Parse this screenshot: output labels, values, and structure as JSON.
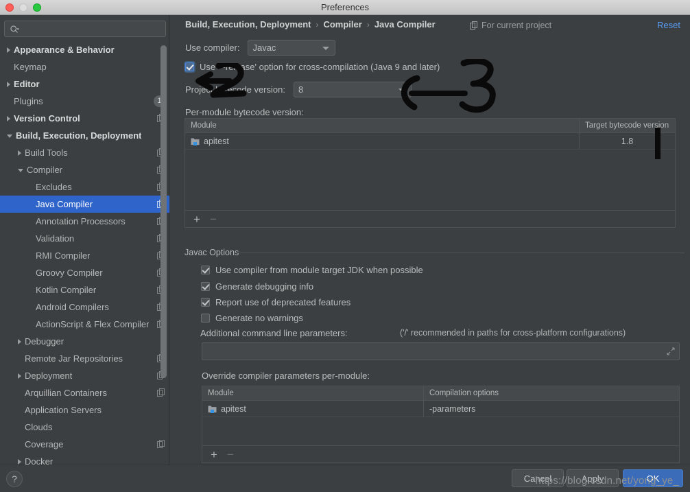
{
  "window": {
    "title": "Preferences",
    "controls": [
      "close",
      "minimize",
      "zoom"
    ]
  },
  "sidebar": {
    "search": {
      "placeholder": "",
      "icon": "search-icon"
    },
    "items": [
      {
        "label": "Appearance & Behavior",
        "depth": 0,
        "arrow": "right",
        "bold": true,
        "copy": false,
        "badge": null,
        "selected": false
      },
      {
        "label": "Keymap",
        "depth": 0,
        "arrow": "none",
        "bold": false,
        "copy": false,
        "badge": null,
        "selected": false
      },
      {
        "label": "Editor",
        "depth": 0,
        "arrow": "right",
        "bold": true,
        "copy": false,
        "badge": null,
        "selected": false
      },
      {
        "label": "Plugins",
        "depth": 0,
        "arrow": "none",
        "bold": false,
        "copy": false,
        "badge": "1",
        "selected": false
      },
      {
        "label": "Version Control",
        "depth": 0,
        "arrow": "right",
        "bold": true,
        "copy": true,
        "badge": null,
        "selected": false
      },
      {
        "label": "Build, Execution, Deployment",
        "depth": 0,
        "arrow": "down",
        "bold": true,
        "copy": false,
        "badge": null,
        "selected": false
      },
      {
        "label": "Build Tools",
        "depth": 1,
        "arrow": "right",
        "bold": false,
        "copy": true,
        "badge": null,
        "selected": false
      },
      {
        "label": "Compiler",
        "depth": 1,
        "arrow": "down",
        "bold": false,
        "copy": true,
        "badge": null,
        "selected": false
      },
      {
        "label": "Excludes",
        "depth": 2,
        "arrow": "none",
        "bold": false,
        "copy": true,
        "badge": null,
        "selected": false
      },
      {
        "label": "Java Compiler",
        "depth": 2,
        "arrow": "none",
        "bold": false,
        "copy": true,
        "badge": null,
        "selected": true
      },
      {
        "label": "Annotation Processors",
        "depth": 2,
        "arrow": "none",
        "bold": false,
        "copy": true,
        "badge": null,
        "selected": false
      },
      {
        "label": "Validation",
        "depth": 2,
        "arrow": "none",
        "bold": false,
        "copy": true,
        "badge": null,
        "selected": false
      },
      {
        "label": "RMI Compiler",
        "depth": 2,
        "arrow": "none",
        "bold": false,
        "copy": true,
        "badge": null,
        "selected": false
      },
      {
        "label": "Groovy Compiler",
        "depth": 2,
        "arrow": "none",
        "bold": false,
        "copy": true,
        "badge": null,
        "selected": false
      },
      {
        "label": "Kotlin Compiler",
        "depth": 2,
        "arrow": "none",
        "bold": false,
        "copy": true,
        "badge": null,
        "selected": false
      },
      {
        "label": "Android Compilers",
        "depth": 2,
        "arrow": "none",
        "bold": false,
        "copy": true,
        "badge": null,
        "selected": false
      },
      {
        "label": "ActionScript & Flex Compiler",
        "depth": 2,
        "arrow": "none",
        "bold": false,
        "copy": true,
        "badge": null,
        "selected": false
      },
      {
        "label": "Debugger",
        "depth": 1,
        "arrow": "right",
        "bold": false,
        "copy": false,
        "badge": null,
        "selected": false
      },
      {
        "label": "Remote Jar Repositories",
        "depth": 1,
        "arrow": "none",
        "bold": false,
        "copy": true,
        "badge": null,
        "selected": false
      },
      {
        "label": "Deployment",
        "depth": 1,
        "arrow": "right",
        "bold": false,
        "copy": true,
        "badge": null,
        "selected": false
      },
      {
        "label": "Arquillian Containers",
        "depth": 1,
        "arrow": "none",
        "bold": false,
        "copy": true,
        "badge": null,
        "selected": false
      },
      {
        "label": "Application Servers",
        "depth": 1,
        "arrow": "none",
        "bold": false,
        "copy": false,
        "badge": null,
        "selected": false
      },
      {
        "label": "Clouds",
        "depth": 1,
        "arrow": "none",
        "bold": false,
        "copy": false,
        "badge": null,
        "selected": false
      },
      {
        "label": "Coverage",
        "depth": 1,
        "arrow": "none",
        "bold": false,
        "copy": true,
        "badge": null,
        "selected": false
      },
      {
        "label": "Docker",
        "depth": 1,
        "arrow": "right",
        "bold": false,
        "copy": false,
        "badge": null,
        "selected": false
      }
    ]
  },
  "header": {
    "breadcrumb": [
      "Build, Execution, Deployment",
      "Compiler",
      "Java Compiler"
    ],
    "separator": "›",
    "scope_label": "For current project",
    "scope_icon": "copy-icon",
    "reset_label": "Reset"
  },
  "main": {
    "use_compiler_label": "Use compiler:",
    "use_compiler_value": "Javac",
    "release_option_label": "Use '--release' option for cross-compilation (Java 9 and later)",
    "release_option_checked": true,
    "project_bytecode_label": "Project bytecode version:",
    "project_bytecode_value": "8",
    "per_module_label": "Per-module bytecode version:",
    "per_module_table": {
      "headers": [
        "Module",
        "Target bytecode version"
      ],
      "rows": [
        {
          "module": "apitest",
          "target": "1.8"
        }
      ],
      "add_label": "+",
      "remove_label": "−"
    },
    "javac_group_title": "Javac Options",
    "javac_options": [
      {
        "label": "Use compiler from module target JDK when possible",
        "checked": true
      },
      {
        "label": "Generate debugging info",
        "checked": true
      },
      {
        "label": "Report use of deprecated features",
        "checked": true
      },
      {
        "label": "Generate no warnings",
        "checked": false
      }
    ],
    "additional_params_label": "Additional command line parameters:",
    "additional_params_hint": "('/' recommended in paths for cross-platform configurations)",
    "additional_params_value": "",
    "override_label": "Override compiler parameters per-module:",
    "override_table": {
      "headers": [
        "Module",
        "Compilation options"
      ],
      "rows": [
        {
          "module": "apitest",
          "options": "-parameters"
        }
      ],
      "add_label": "+",
      "remove_label": "−"
    }
  },
  "footer": {
    "help_label": "?",
    "cancel_label": "Cancel",
    "apply_label": "Apply",
    "ok_label": "OK",
    "watermark": "https://blog.csdn.net/yong_ye_"
  },
  "annotations": [
    {
      "name": "hand-drawn-2",
      "text": "2"
    },
    {
      "name": "hand-drawn-3",
      "text": "3"
    },
    {
      "name": "hand-drawn-bar",
      "text": ""
    }
  ],
  "colors": {
    "accent": "#2f65ca",
    "link": "#589df6",
    "panel_bg": "#3c3f41",
    "primary_button": "#3b6cb9",
    "annotation": "#000000"
  }
}
